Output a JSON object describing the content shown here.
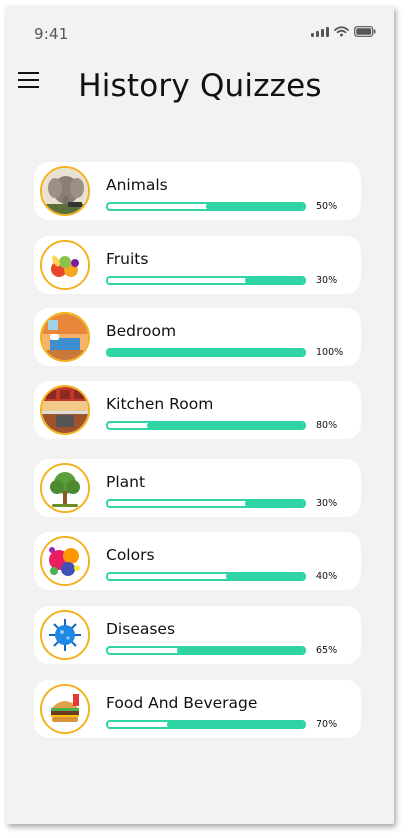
{
  "status_bar": {
    "time": "9:41"
  },
  "header": {
    "title": "History Quizzes"
  },
  "quizzes": [
    {
      "label": "Animals",
      "progress": 0.5,
      "percent_label": "50%",
      "icon": "elephant-icon"
    },
    {
      "label": "Fruits",
      "progress": 0.3,
      "percent_label": "30%",
      "icon": "fruit-icon"
    },
    {
      "label": "Bedroom",
      "progress": 1.0,
      "percent_label": "100%",
      "icon": "bed-icon"
    },
    {
      "label": "Kitchen Room",
      "progress": 0.8,
      "percent_label": "80%",
      "icon": "kitchen-icon"
    },
    {
      "label": "Plant",
      "progress": 0.3,
      "percent_label": "30%",
      "icon": "tree-icon"
    },
    {
      "label": "Colors",
      "progress": 0.4,
      "percent_label": "40%",
      "icon": "paint-splash-icon"
    },
    {
      "label": "Diseases",
      "progress": 0.65,
      "percent_label": "65%",
      "icon": "virus-icon"
    },
    {
      "label": "Food And Beverage",
      "progress": 0.7,
      "percent_label": "70%",
      "icon": "burger-icon"
    }
  ],
  "colors": {
    "accent": "#2fd4a4",
    "avatar_border": "#f2b21b",
    "background": "#f2f2f2"
  }
}
